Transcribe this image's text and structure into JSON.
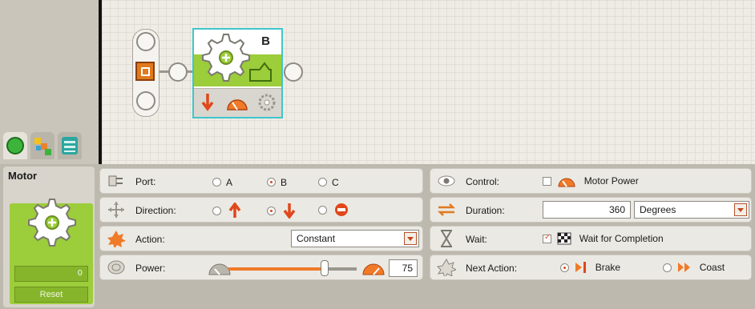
{
  "block": {
    "port_letter": "B"
  },
  "motor_panel": {
    "title": "Motor",
    "counter": "0",
    "reset_label": "Reset"
  },
  "port": {
    "label": "Port:",
    "options": [
      "A",
      "B",
      "C"
    ],
    "selected": "B"
  },
  "direction": {
    "label": "Direction:",
    "selected": "backward"
  },
  "action": {
    "label": "Action:",
    "value": "Constant"
  },
  "power": {
    "label": "Power:",
    "value": "75",
    "level_percent": 75
  },
  "control": {
    "label": "Control:",
    "option_label": "Motor Power",
    "checked": false
  },
  "duration": {
    "label": "Duration:",
    "value": "360",
    "unit": "Degrees"
  },
  "wait": {
    "label": "Wait:",
    "option_label": "Wait for Completion",
    "checked": true
  },
  "next_action": {
    "label": "Next Action:",
    "options": [
      "Brake",
      "Coast"
    ],
    "selected": "Brake"
  },
  "colors": {
    "accent_green": "#9ccd3a",
    "accent_orange": "#f07a28",
    "selection_cyan": "#3fc6cc"
  },
  "icons": [
    "gear-icon",
    "sequence-beam-icon",
    "common-palette-icon",
    "complete-palette-icon",
    "custom-palette-icon",
    "port-icon",
    "direction-icon",
    "action-icon",
    "power-icon",
    "control-icon",
    "duration-icon",
    "wait-icon",
    "next-action-icon",
    "speedometer-icon",
    "checkered-flag-icon",
    "brake-icon",
    "coast-icon"
  ]
}
